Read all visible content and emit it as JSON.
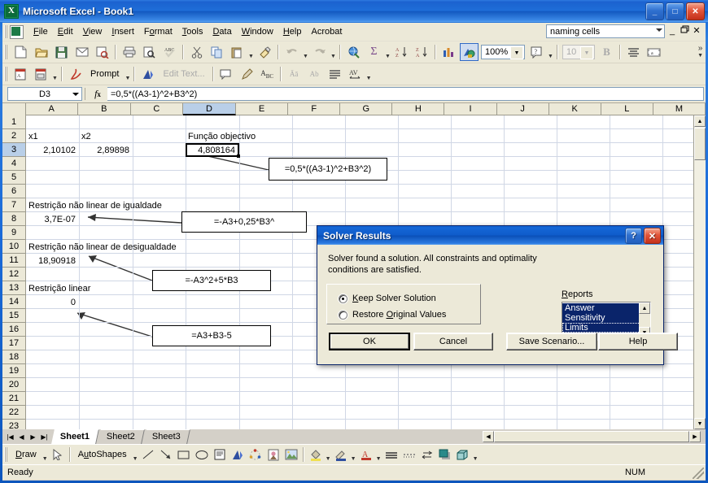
{
  "window": {
    "title": "Microsoft Excel - Book1",
    "icon": "excel-icon",
    "minimize": "_",
    "maximize": "□",
    "close": "✕"
  },
  "menubar": {
    "items": [
      {
        "label": "File"
      },
      {
        "label": "Edit"
      },
      {
        "label": "View"
      },
      {
        "label": "Insert"
      },
      {
        "label": "Format"
      },
      {
        "label": "Tools"
      },
      {
        "label": "Data"
      },
      {
        "label": "Window"
      },
      {
        "label": "Help"
      },
      {
        "label": "Acrobat"
      }
    ],
    "ask_box_value": "naming cells",
    "minimize": "_",
    "restore": "🗗",
    "close": "✕"
  },
  "standard_toolbar": {
    "zoom_value": "100%",
    "font_size_value": "10",
    "bold_label": "B",
    "overflow_label": "»"
  },
  "acrobat_toolbar": {
    "prompt_label": "Prompt",
    "edit_text_label": "Edit Text...",
    "abc_label": "AB",
    "av_label": "AV"
  },
  "formula_bar": {
    "name_box": "D3",
    "fx_label": "fx",
    "formula": "=0,5*((A3-1)^2+B3^2)"
  },
  "grid": {
    "columns": [
      "A",
      "B",
      "C",
      "D",
      "E",
      "F",
      "G",
      "H",
      "I",
      "J",
      "K",
      "L",
      "M"
    ],
    "selected_column": "D",
    "selected_row": "3",
    "rows": [
      "1",
      "2",
      "3",
      "4",
      "5",
      "6",
      "7",
      "8",
      "9",
      "10",
      "11",
      "12",
      "13",
      "14",
      "15",
      "16",
      "17",
      "18",
      "19",
      "20",
      "21",
      "22",
      "23"
    ],
    "cells": [
      {
        "ref": "A2",
        "col": 0,
        "row": 2,
        "value": "x1",
        "align": "left"
      },
      {
        "ref": "B2",
        "col": 1,
        "row": 2,
        "value": "x2",
        "align": "left"
      },
      {
        "ref": "D2",
        "col": 3,
        "row": 2,
        "value": "Função objectivo",
        "align": "left"
      },
      {
        "ref": "A3",
        "col": 0,
        "row": 3,
        "value": "2,10102",
        "align": "right"
      },
      {
        "ref": "B3",
        "col": 1,
        "row": 3,
        "value": "2,89898",
        "align": "right"
      },
      {
        "ref": "A7",
        "col": 0,
        "row": 7,
        "value": "Restrição não linear de igualdade",
        "align": "left"
      },
      {
        "ref": "A8",
        "col": 0,
        "row": 8,
        "value": "3,7E-07",
        "align": "right"
      },
      {
        "ref": "A10",
        "col": 0,
        "row": 10,
        "value": "Restrição não linear de desigualdade",
        "align": "left"
      },
      {
        "ref": "A11",
        "col": 0,
        "row": 11,
        "value": "18,90918",
        "align": "right"
      },
      {
        "ref": "A13",
        "col": 0,
        "row": 13,
        "value": "Restrição linear",
        "align": "left"
      },
      {
        "ref": "A14",
        "col": 0,
        "row": 14,
        "value": "0",
        "align": "right"
      }
    ],
    "selected_cell": {
      "ref": "D3",
      "value": "4,808164"
    },
    "callouts": [
      {
        "name": "callout-objective",
        "text": "=0,5*((A3-1)^2+B3^2)"
      },
      {
        "name": "callout-nonlinear-equality",
        "text": "=-A3+0,25*B3^"
      },
      {
        "name": "callout-nonlinear-inequality",
        "text": "=-A3^2+5*B3"
      },
      {
        "name": "callout-linear",
        "text": "=A3+B3-5"
      }
    ]
  },
  "sheet_tabs": {
    "tabs": [
      {
        "label": "Sheet1",
        "active": true
      },
      {
        "label": "Sheet2",
        "active": false
      },
      {
        "label": "Sheet3",
        "active": false
      }
    ]
  },
  "drawing_toolbar": {
    "draw_label": "Draw",
    "autoshapes_label": "AutoShapes"
  },
  "status_bar": {
    "left_text": "Ready",
    "num_indicator": "NUM"
  },
  "dialog": {
    "title": "Solver Results",
    "help_button": "?",
    "close_button": "✕",
    "message_line1": "Solver found a solution.  All constraints and optimality",
    "message_line2": "conditions are satisfied.",
    "radios": [
      {
        "label": "Keep Solver Solution",
        "selected": true
      },
      {
        "label": "Restore Original Values",
        "selected": false
      }
    ],
    "reports_label": "Reports",
    "reports": [
      {
        "label": "Answer",
        "selected": true
      },
      {
        "label": "Sensitivity",
        "selected": true
      },
      {
        "label": "Limits",
        "selected": true
      }
    ],
    "buttons": [
      {
        "label": "OK",
        "default": true
      },
      {
        "label": "Cancel",
        "default": false
      },
      {
        "label": "Save Scenario...",
        "default": false
      },
      {
        "label": "Help",
        "default": false
      }
    ]
  },
  "colors": {
    "titlebar_blue": "#1b62cf",
    "dialog_blue": "#0a4fb8",
    "toolbar_bg": "#ece9d8",
    "selection_blue": "#0a246a",
    "header_selected": "#b9cfe8"
  }
}
